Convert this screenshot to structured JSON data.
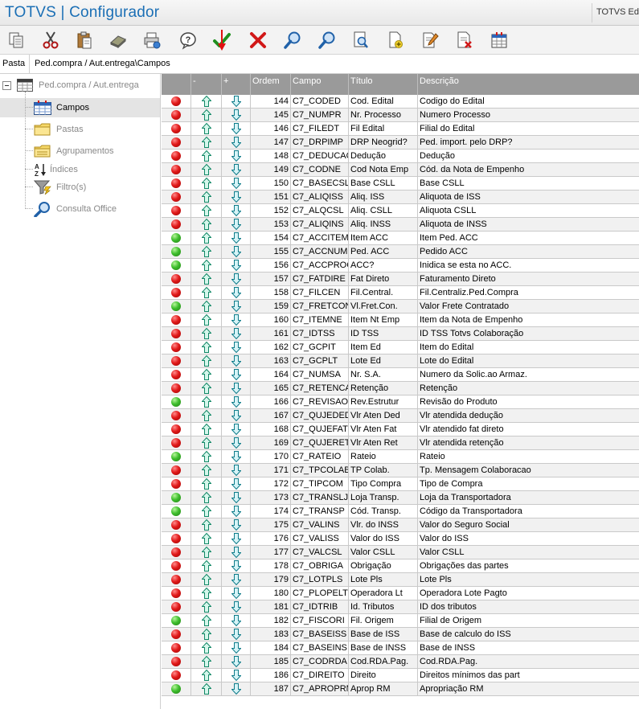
{
  "window": {
    "title": "TOTVS | Configurador",
    "right_title": "TOTVS Ed"
  },
  "toolbar": {
    "buttons": [
      {
        "name": "copy-button",
        "icon": "copy-icon"
      },
      {
        "name": "cut-button",
        "icon": "scissors-icon"
      },
      {
        "name": "paste-button",
        "icon": "clipboard-icon"
      },
      {
        "name": "eraser-button",
        "icon": "eraser-icon"
      },
      {
        "name": "printer-button",
        "icon": "printer-icon"
      },
      {
        "name": "help-button",
        "icon": "question-icon"
      },
      {
        "name": "confirm-button",
        "icon": "checkmark-icon"
      },
      {
        "name": "cancel-button",
        "icon": "x-icon"
      },
      {
        "name": "search-button",
        "icon": "magnifier-icon"
      },
      {
        "name": "search-next-button",
        "icon": "magnifier-icon"
      },
      {
        "name": "preview-button",
        "icon": "preview-icon"
      },
      {
        "name": "new-button",
        "icon": "new-document-icon"
      },
      {
        "name": "edit-button",
        "icon": "edit-document-icon"
      },
      {
        "name": "delete-button",
        "icon": "delete-document-icon"
      },
      {
        "name": "structure-button",
        "icon": "table-icon"
      }
    ]
  },
  "pathbar": {
    "label": "Pasta",
    "path": "Ped.compra / Aut.entrega\\Campos"
  },
  "tree": {
    "root": "Ped.compra / Aut.entrega",
    "items": [
      {
        "label": "Campos",
        "icon": "table-icon",
        "selected": true
      },
      {
        "label": "Pastas",
        "icon": "folder-icon",
        "selected": false
      },
      {
        "label": "Agrupamentos",
        "icon": "folder-stack-icon",
        "selected": false
      },
      {
        "label": "Índices",
        "icon": "sort-az-icon",
        "selected": false
      },
      {
        "label": "Filtro(s)",
        "icon": "filter-icon",
        "selected": false
      },
      {
        "label": "Consulta Office",
        "icon": "magnifier-icon",
        "selected": false
      }
    ]
  },
  "grid": {
    "columns": [
      "",
      "-",
      "+",
      "Ordem",
      "Campo",
      "Título",
      "Descrição"
    ],
    "rows": [
      {
        "status": "red",
        "ordem": "144",
        "campo": "C7_CODED",
        "titulo": "Cod. Edital",
        "descricao": "Codigo do Edital"
      },
      {
        "status": "red",
        "ordem": "145",
        "campo": "C7_NUMPR",
        "titulo": "Nr. Processo",
        "descricao": "Numero Processo"
      },
      {
        "status": "red",
        "ordem": "146",
        "campo": "C7_FILEDT",
        "titulo": "Fil Edital",
        "descricao": "Filial do Edital"
      },
      {
        "status": "red",
        "ordem": "147",
        "campo": "C7_DRPIMP",
        "titulo": "DRP Neogrid?",
        "descricao": "Ped. import. pelo DRP?"
      },
      {
        "status": "red",
        "ordem": "148",
        "campo": "C7_DEDUCAO",
        "titulo": "Dedução",
        "descricao": "Dedução"
      },
      {
        "status": "red",
        "ordem": "149",
        "campo": "C7_CODNE",
        "titulo": "Cod Nota Emp",
        "descricao": "Cód. da Nota de Empenho"
      },
      {
        "status": "red",
        "ordem": "150",
        "campo": "C7_BASECSL",
        "titulo": "Base CSLL",
        "descricao": "Base CSLL"
      },
      {
        "status": "red",
        "ordem": "151",
        "campo": "C7_ALIQISS",
        "titulo": "Aliq. ISS",
        "descricao": "Aliquota de ISS"
      },
      {
        "status": "red",
        "ordem": "152",
        "campo": "C7_ALQCSL",
        "titulo": "Aliq. CSLL",
        "descricao": "Aliquota CSLL"
      },
      {
        "status": "red",
        "ordem": "153",
        "campo": "C7_ALIQINS",
        "titulo": "Aliq. INSS",
        "descricao": "Aliquota de INSS"
      },
      {
        "status": "green",
        "ordem": "154",
        "campo": "C7_ACCITEM",
        "titulo": "Item ACC",
        "descricao": "Item Ped. ACC"
      },
      {
        "status": "green",
        "ordem": "155",
        "campo": "C7_ACCNUM",
        "titulo": "Ped. ACC",
        "descricao": "Pedido ACC"
      },
      {
        "status": "green",
        "ordem": "156",
        "campo": "C7_ACCPROC",
        "titulo": "ACC?",
        "descricao": "Inidica se esta no ACC."
      },
      {
        "status": "red",
        "ordem": "157",
        "campo": "C7_FATDIRE",
        "titulo": "Fat Direto",
        "descricao": "Faturamento Direto"
      },
      {
        "status": "red",
        "ordem": "158",
        "campo": "C7_FILCEN",
        "titulo": "Fil.Central.",
        "descricao": "Fil.Centraliz.Ped.Compra"
      },
      {
        "status": "green",
        "ordem": "159",
        "campo": "C7_FRETCON",
        "titulo": "Vl.Fret.Con.",
        "descricao": "Valor Frete Contratado"
      },
      {
        "status": "red",
        "ordem": "160",
        "campo": "C7_ITEMNE",
        "titulo": "Item Nt Emp",
        "descricao": "Item da Nota de Empenho"
      },
      {
        "status": "red",
        "ordem": "161",
        "campo": "C7_IDTSS",
        "titulo": "ID TSS",
        "descricao": "ID TSS Totvs Colaboração"
      },
      {
        "status": "red",
        "ordem": "162",
        "campo": "C7_GCPIT",
        "titulo": "Item Ed",
        "descricao": "Item do Edital"
      },
      {
        "status": "red",
        "ordem": "163",
        "campo": "C7_GCPLT",
        "titulo": "Lote Ed",
        "descricao": "Lote do Edital"
      },
      {
        "status": "red",
        "ordem": "164",
        "campo": "C7_NUMSA",
        "titulo": "Nr. S.A.",
        "descricao": "Numero da Solic.ao Armaz."
      },
      {
        "status": "red",
        "ordem": "165",
        "campo": "C7_RETENCA",
        "titulo": "Retenção",
        "descricao": "Retenção"
      },
      {
        "status": "green",
        "ordem": "166",
        "campo": "C7_REVISAO",
        "titulo": "Rev.Estrutur",
        "descricao": "Revisão do Produto"
      },
      {
        "status": "red",
        "ordem": "167",
        "campo": "C7_QUJEDED",
        "titulo": "Vlr Aten Ded",
        "descricao": "Vlr atendida dedução"
      },
      {
        "status": "red",
        "ordem": "168",
        "campo": "C7_QUJEFAT",
        "titulo": "Vlr Aten Fat",
        "descricao": "Vlr atendido fat direto"
      },
      {
        "status": "red",
        "ordem": "169",
        "campo": "C7_QUJERET",
        "titulo": "Vlr Aten Ret",
        "descricao": "Vlr atendida retenção"
      },
      {
        "status": "green",
        "ordem": "170",
        "campo": "C7_RATEIO",
        "titulo": "Rateio",
        "descricao": "Rateio"
      },
      {
        "status": "red",
        "ordem": "171",
        "campo": "C7_TPCOLAB",
        "titulo": "TP Colab.",
        "descricao": "Tp. Mensagem Colaboracao"
      },
      {
        "status": "red",
        "ordem": "172",
        "campo": "C7_TIPCOM",
        "titulo": "Tipo Compra",
        "descricao": "Tipo de Compra"
      },
      {
        "status": "green",
        "ordem": "173",
        "campo": "C7_TRANSLJ",
        "titulo": "Loja Transp.",
        "descricao": "Loja da Transportadora"
      },
      {
        "status": "green",
        "ordem": "174",
        "campo": "C7_TRANSP",
        "titulo": "Cód. Transp.",
        "descricao": "Código da Transportadora"
      },
      {
        "status": "red",
        "ordem": "175",
        "campo": "C7_VALINS",
        "titulo": "Vlr. do INSS",
        "descricao": "Valor do Seguro Social"
      },
      {
        "status": "red",
        "ordem": "176",
        "campo": "C7_VALISS",
        "titulo": "Valor do ISS",
        "descricao": "Valor do ISS"
      },
      {
        "status": "red",
        "ordem": "177",
        "campo": "C7_VALCSL",
        "titulo": "Valor CSLL",
        "descricao": "Valor CSLL"
      },
      {
        "status": "red",
        "ordem": "178",
        "campo": "C7_OBRIGA",
        "titulo": "Obrigação",
        "descricao": "Obrigações das partes"
      },
      {
        "status": "red",
        "ordem": "179",
        "campo": "C7_LOTPLS",
        "titulo": "Lote Pls",
        "descricao": "Lote Pls"
      },
      {
        "status": "red",
        "ordem": "180",
        "campo": "C7_PLOPELT",
        "titulo": "Operadora Lt",
        "descricao": "Operadora Lote Pagto"
      },
      {
        "status": "red",
        "ordem": "181",
        "campo": "C7_IDTRIB",
        "titulo": "Id. Tributos",
        "descricao": "ID dos tributos"
      },
      {
        "status": "green",
        "ordem": "182",
        "campo": "C7_FISCORI",
        "titulo": "Fil. Origem",
        "descricao": "Filial de Origem"
      },
      {
        "status": "red",
        "ordem": "183",
        "campo": "C7_BASEISS",
        "titulo": "Base de ISS",
        "descricao": "Base de calculo do ISS"
      },
      {
        "status": "red",
        "ordem": "184",
        "campo": "C7_BASEINS",
        "titulo": "Base de INSS",
        "descricao": "Base de INSS"
      },
      {
        "status": "red",
        "ordem": "185",
        "campo": "C7_CODRDA",
        "titulo": "Cod.RDA.Pag.",
        "descricao": "Cod.RDA.Pag."
      },
      {
        "status": "red",
        "ordem": "186",
        "campo": "C7_DIREITO",
        "titulo": "Direito",
        "descricao": "Direitos mínimos das part"
      },
      {
        "status": "green",
        "ordem": "187",
        "campo": "C7_APROPRM",
        "titulo": "Aprop RM",
        "descricao": "Apropriação RM"
      }
    ]
  }
}
